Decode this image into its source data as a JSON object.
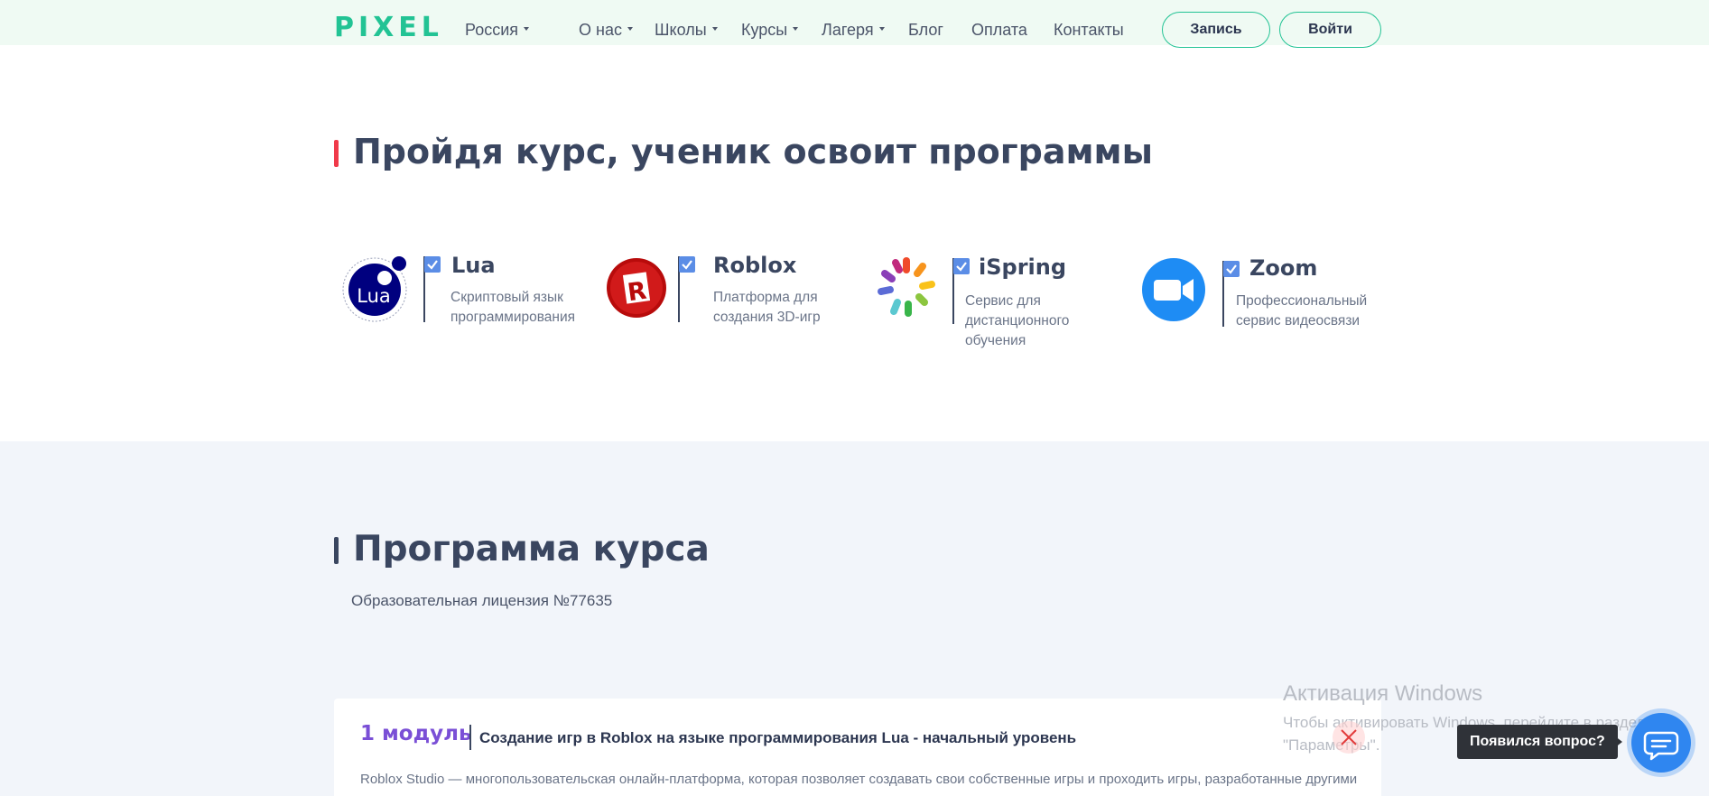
{
  "header": {
    "logo": "PIXEL",
    "region": "Россия",
    "nav": [
      "О нас",
      "Школы",
      "Курсы",
      "Лагеря",
      "Блог",
      "Оплата",
      "Контакты"
    ],
    "signup_label": "Запись",
    "login_label": "Войти",
    "colors": {
      "accent": "#22c394",
      "background": "#effaf3"
    }
  },
  "programs_section": {
    "title": "Пройдя курс, ученик освоит программы",
    "items": [
      {
        "name": "Lua",
        "description": "Скриптовый язык программирования",
        "logo_text": "Lua",
        "icon": "lua-logo-icon"
      },
      {
        "name": "Roblox",
        "description": "Платформа для создания 3D-игр",
        "logo_text": "R",
        "icon": "roblox-logo-icon"
      },
      {
        "name": "iSpring",
        "description": "Сервис для дистанционного обучения",
        "icon": "ispring-logo-icon"
      },
      {
        "name": "Zoom",
        "description": "Профессиональный сервис видеосвязи",
        "icon": "zoom-logo-icon"
      }
    ]
  },
  "program_section": {
    "title": "Программа курса",
    "license": "Образовательная лицензия №77635",
    "module": {
      "number": "1 модуль",
      "title": "Создание игр в Roblox на языке программирования Lua - начальный уровень",
      "description": "Roblox Studio — многопользовательская онлайн-платформа, которая позволяет создавать свои собственные игры и проходить игры, разработанные другими пользователями."
    }
  },
  "windows_watermark": {
    "title": "Активация Windows",
    "subtitle": "Чтобы активировать Windows, перейдите в раздел\n\"Параметры\"."
  },
  "chat": {
    "tooltip": "Появился вопрос?",
    "icon": "chat-bubble-icon",
    "close_icon": "close-icon"
  }
}
